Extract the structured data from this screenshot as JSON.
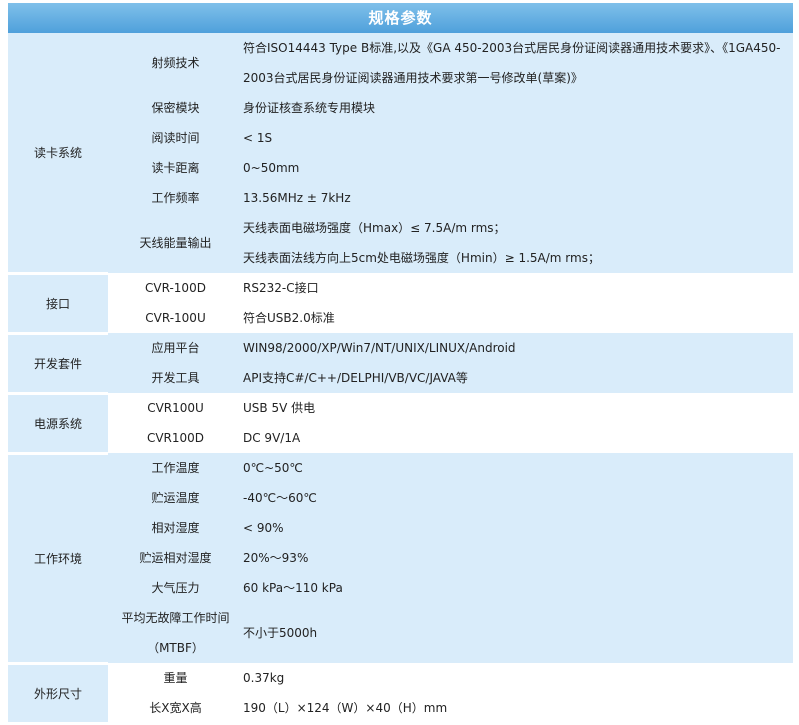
{
  "title": "规格参数",
  "sections": [
    {
      "category": "读卡系统",
      "rows": [
        {
          "key": "射频技术",
          "value": [
            "符合ISO14443 Type B标准,以及《GA 450-2003台式居民身份证阅读器通用技术要求》、《1GA450-",
            "2003台式居民身份证阅读器通用技术要求第一号修改单(草案)》"
          ]
        },
        {
          "key": "保密模块",
          "value": [
            "身份证核查系统专用模块"
          ]
        },
        {
          "key": "阅读时间",
          "value": [
            "< 1S"
          ]
        },
        {
          "key": "读卡距离",
          "value": [
            "0~50mm"
          ]
        },
        {
          "key": "工作频率",
          "value": [
            "13.56MHz ± 7kHz"
          ]
        },
        {
          "key": "天线能量输出",
          "value": [
            "天线表面电磁场强度（Hmax）≤ 7.5A/m rms；",
            "天线表面法线方向上5cm处电磁场强度（Hmin）≥ 1.5A/m rms；"
          ]
        }
      ]
    },
    {
      "category": "接口",
      "rows": [
        {
          "key": "CVR-100D",
          "value": [
            "RS232-C接口"
          ]
        },
        {
          "key": "CVR-100U",
          "value": [
            "符合USB2.0标准"
          ]
        }
      ]
    },
    {
      "category": "开发套件",
      "rows": [
        {
          "key": "应用平台",
          "value": [
            "WIN98/2000/XP/Win7/NT/UNIX/LINUX/Android"
          ]
        },
        {
          "key": "开发工具",
          "value": [
            "API支持C#/C++/DELPHI/VB/VC/JAVA等"
          ]
        }
      ]
    },
    {
      "category": "电源系统",
      "rows": [
        {
          "key": "CVR100U",
          "value": [
            "USB 5V 供电"
          ]
        },
        {
          "key": "CVR100D",
          "value": [
            "DC 9V/1A"
          ]
        }
      ]
    },
    {
      "category": "工作环境",
      "rows": [
        {
          "key": "工作温度",
          "value": [
            "0℃~50℃"
          ]
        },
        {
          "key": "贮运温度",
          "value": [
            "-40℃～60℃"
          ]
        },
        {
          "key": "相对湿度",
          "value": [
            "< 90%"
          ]
        },
        {
          "key": "贮运相对湿度",
          "value": [
            "20%～93%"
          ]
        },
        {
          "key": "大气压力",
          "value": [
            "60 kPa～110 kPa"
          ]
        },
        {
          "key": "平均无故障工作时间（MTBF）",
          "keyLines": [
            "平均无故障工作时间",
            "（MTBF）"
          ],
          "value": [
            "不小于5000h"
          ]
        }
      ]
    },
    {
      "category": "外形尺寸",
      "rows": [
        {
          "key": "重量",
          "value": [
            "0.37kg"
          ]
        },
        {
          "key": "长X宽X高",
          "value": [
            "190（L）×124（W）×40（H）mm"
          ]
        }
      ]
    }
  ]
}
